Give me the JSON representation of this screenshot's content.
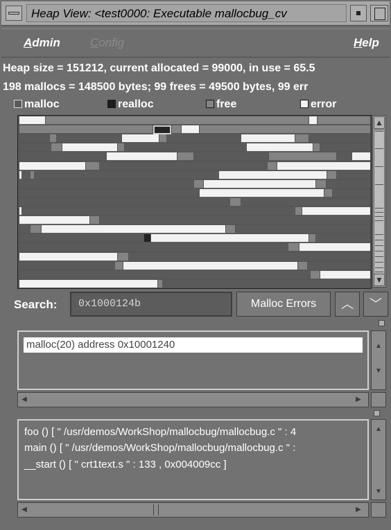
{
  "window": {
    "title": "Heap View: <test0000: Executable mallocbug_cv"
  },
  "menu": {
    "items": [
      {
        "accel": "A",
        "rest": "dmin",
        "enabled": true
      },
      {
        "accel": "C",
        "rest": "onfig",
        "enabled": false
      },
      {
        "accel": "H",
        "rest": "elp",
        "enabled": true
      }
    ]
  },
  "info": {
    "line1": "Heap size = 151212, current allocated = 99000, in use = 65.5",
    "line2": "198 mallocs = 148500 bytes;  99 frees = 49500 bytes,  99 err"
  },
  "legend": {
    "malloc": "malloc",
    "realloc": "realloc",
    "free": "free",
    "error": "error"
  },
  "colors": {
    "malloc": "#5a5a5a",
    "free": "#838383",
    "error": "#f2f2f2",
    "realloc": "#1e1e1e",
    "background": "#6e6e6e"
  },
  "search": {
    "label": "Search:",
    "value": "0x1000124b",
    "malloc_errors_button": "Malloc Errors",
    "prev_icon": "chevron-up-icon",
    "next_icon": "chevron-down-icon"
  },
  "list": {
    "items": [
      "malloc(20) address 0x10001240"
    ]
  },
  "trace": {
    "lines": [
      "foo () [ \" /usr/demos/WorkShop/mallocbug/mallocbug.c \" : 4",
      "main () [ \" /usr/demos/WorkShop/mallocbug/mallocbug.c \" :",
      "__start () [ \" crt1text.s \" : 133 , 0x004009cc ]"
    ]
  }
}
